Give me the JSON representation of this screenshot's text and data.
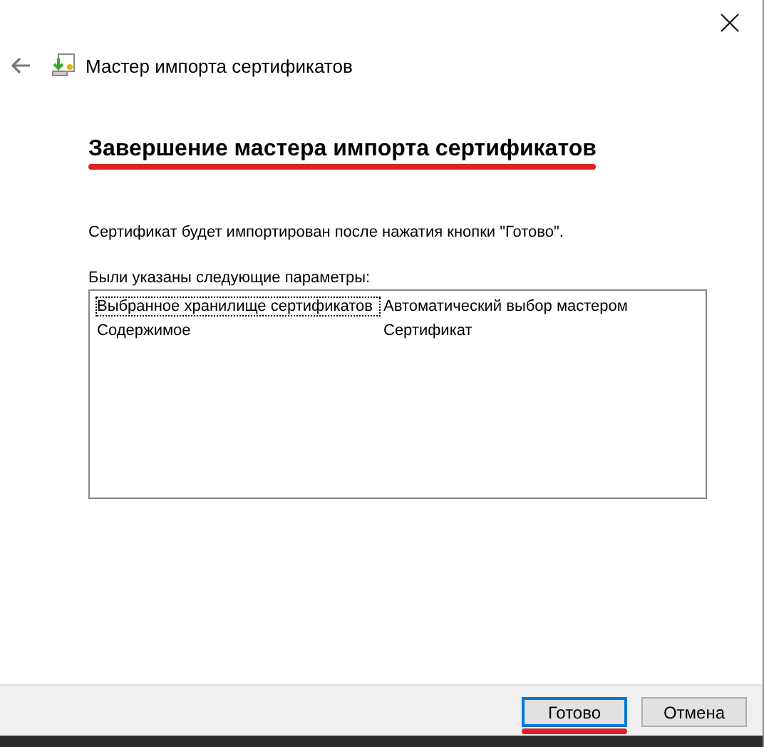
{
  "window": {
    "title": "Мастер импорта сертификатов"
  },
  "heading": {
    "text": "Завершение мастера импорта сертификатов",
    "highlighted": true
  },
  "intro": "Сертификат будет импортирован после нажатия кнопки \"Готово\".",
  "settings_label": "Были указаны следующие параметры:",
  "settings": [
    {
      "name": "Выбранное хранилище сертификатов",
      "value": "Автоматический выбор мастером",
      "focused": true
    },
    {
      "name": "Содержимое",
      "value": "Сертификат",
      "focused": false
    }
  ],
  "buttons": [
    {
      "label": "Готово",
      "default": true,
      "highlighted": true
    },
    {
      "label": "Отмена",
      "default": false,
      "highlighted": false
    }
  ]
}
